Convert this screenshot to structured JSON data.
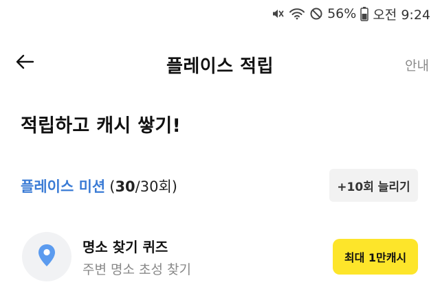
{
  "status_bar": {
    "battery": "56%",
    "time": "오전 9:24",
    "icons": [
      "mute-icon",
      "wifi-icon",
      "do-not-disturb-icon",
      "battery-icon"
    ]
  },
  "app_bar": {
    "title": "플레이스 적립",
    "guide_label": "안내",
    "back_icon": "arrow-left-icon"
  },
  "headline": "적립하고 캐시 쌓기!",
  "mission": {
    "name": "플레이스 미션",
    "count_open": "(",
    "count_current": "30",
    "count_rest": "/30회)",
    "extend_label": "+10회 늘리기"
  },
  "mission_item": {
    "icon": "map-pin-icon",
    "title": "명소 찾기 퀴즈",
    "subtitle": "주변 명소 초성 찾기",
    "reward_label": "최대 1만캐시"
  },
  "colors": {
    "accent_blue": "#3a7bd5",
    "reward_yellow": "#fde52a",
    "secondary_gray": "#888888",
    "button_gray": "#f2f2f2",
    "pin_blue": "#5b9bef"
  }
}
